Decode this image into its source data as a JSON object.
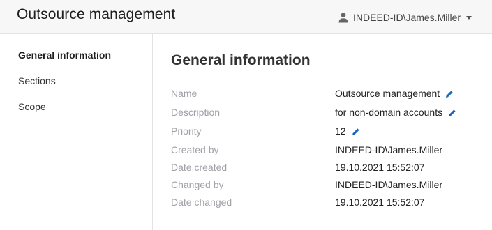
{
  "header": {
    "title": "Outsource management",
    "user": "INDEED-ID\\James.Miller",
    "user_icon": "person-icon",
    "caret_icon": "caret-down-icon"
  },
  "sidebar": {
    "items": [
      {
        "label": "General information",
        "active": true
      },
      {
        "label": "Sections",
        "active": false
      },
      {
        "label": "Scope",
        "active": false
      }
    ]
  },
  "main": {
    "title": "General information",
    "rows": [
      {
        "label": "Name",
        "value": "Outsource management",
        "editable": true
      },
      {
        "label": "Description",
        "value": "for non-domain accounts",
        "editable": true
      },
      {
        "label": "Priority",
        "value": "12",
        "editable": true
      },
      {
        "label": "Created by",
        "value": "INDEED-ID\\James.Miller",
        "editable": false
      },
      {
        "label": "Date created",
        "value": "19.10.2021 15:52:07",
        "editable": false
      },
      {
        "label": "Changed by",
        "value": "INDEED-ID\\James.Miller",
        "editable": false
      },
      {
        "label": "Date changed",
        "value": "19.10.2021 15:52:07",
        "editable": false
      }
    ],
    "edit_icon": "pencil-icon"
  },
  "colors": {
    "accent": "#1565c0",
    "header_bg": "#f7f7f8",
    "label": "#a0a0a8"
  }
}
